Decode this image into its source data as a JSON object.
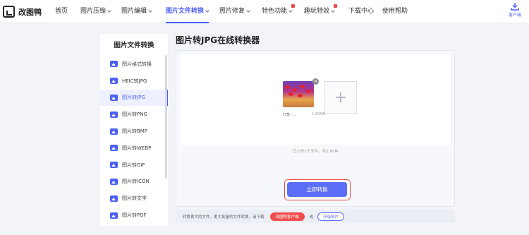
{
  "app": {
    "logo_text": "改图鸭"
  },
  "nav": {
    "items": [
      {
        "label": "首页",
        "dropdown": false,
        "active": false,
        "hot": false
      },
      {
        "label": "图片压缩",
        "dropdown": true,
        "active": false,
        "hot": false
      },
      {
        "label": "图片编辑",
        "dropdown": true,
        "active": false,
        "hot": false
      },
      {
        "label": "图片文件转换",
        "dropdown": true,
        "active": true,
        "hot": false
      },
      {
        "label": "照片修复",
        "dropdown": true,
        "active": false,
        "hot": false
      },
      {
        "label": "特色功能",
        "dropdown": true,
        "active": false,
        "hot": true
      },
      {
        "label": "趣玩特效",
        "dropdown": true,
        "active": false,
        "hot": true
      },
      {
        "label": "下载中心",
        "dropdown": false,
        "active": false,
        "hot": false
      },
      {
        "label": "使用帮助",
        "dropdown": false,
        "active": false,
        "hot": false
      }
    ],
    "client_label": "客户端"
  },
  "sidebar": {
    "title": "图片文件转换",
    "items": [
      {
        "label": "图片格式转换",
        "active": false
      },
      {
        "label": "HEIC转JPG",
        "active": false
      },
      {
        "label": "图片转JPG",
        "active": true
      },
      {
        "label": "图片转PNG",
        "active": false
      },
      {
        "label": "图片转BMP",
        "active": false
      },
      {
        "label": "图片转WEBP",
        "active": false
      },
      {
        "label": "图片转GIF",
        "active": false
      },
      {
        "label": "图片转ICON",
        "active": false
      },
      {
        "label": "图片转文字",
        "active": false
      },
      {
        "label": "图片转PDF",
        "active": false
      }
    ]
  },
  "main": {
    "title": "图片转JPG在线转换器",
    "file": {
      "name": "灯笼 - ...",
      "size": "1.60MB"
    },
    "upload_summary": "已上传1个文件，共1.60M",
    "convert_label": "立即转换"
  },
  "footer": {
    "text": "转换更大的文件、更大批量的文件转换，请下载",
    "client_button": "改图鸭客户端",
    "or_text": "或",
    "upgrade_button": "升级账户"
  },
  "colors": {
    "accent": "#4b5ff5",
    "button": "#5b6ef6",
    "highlight": "#ea4b4b",
    "hot": "#f04444"
  }
}
